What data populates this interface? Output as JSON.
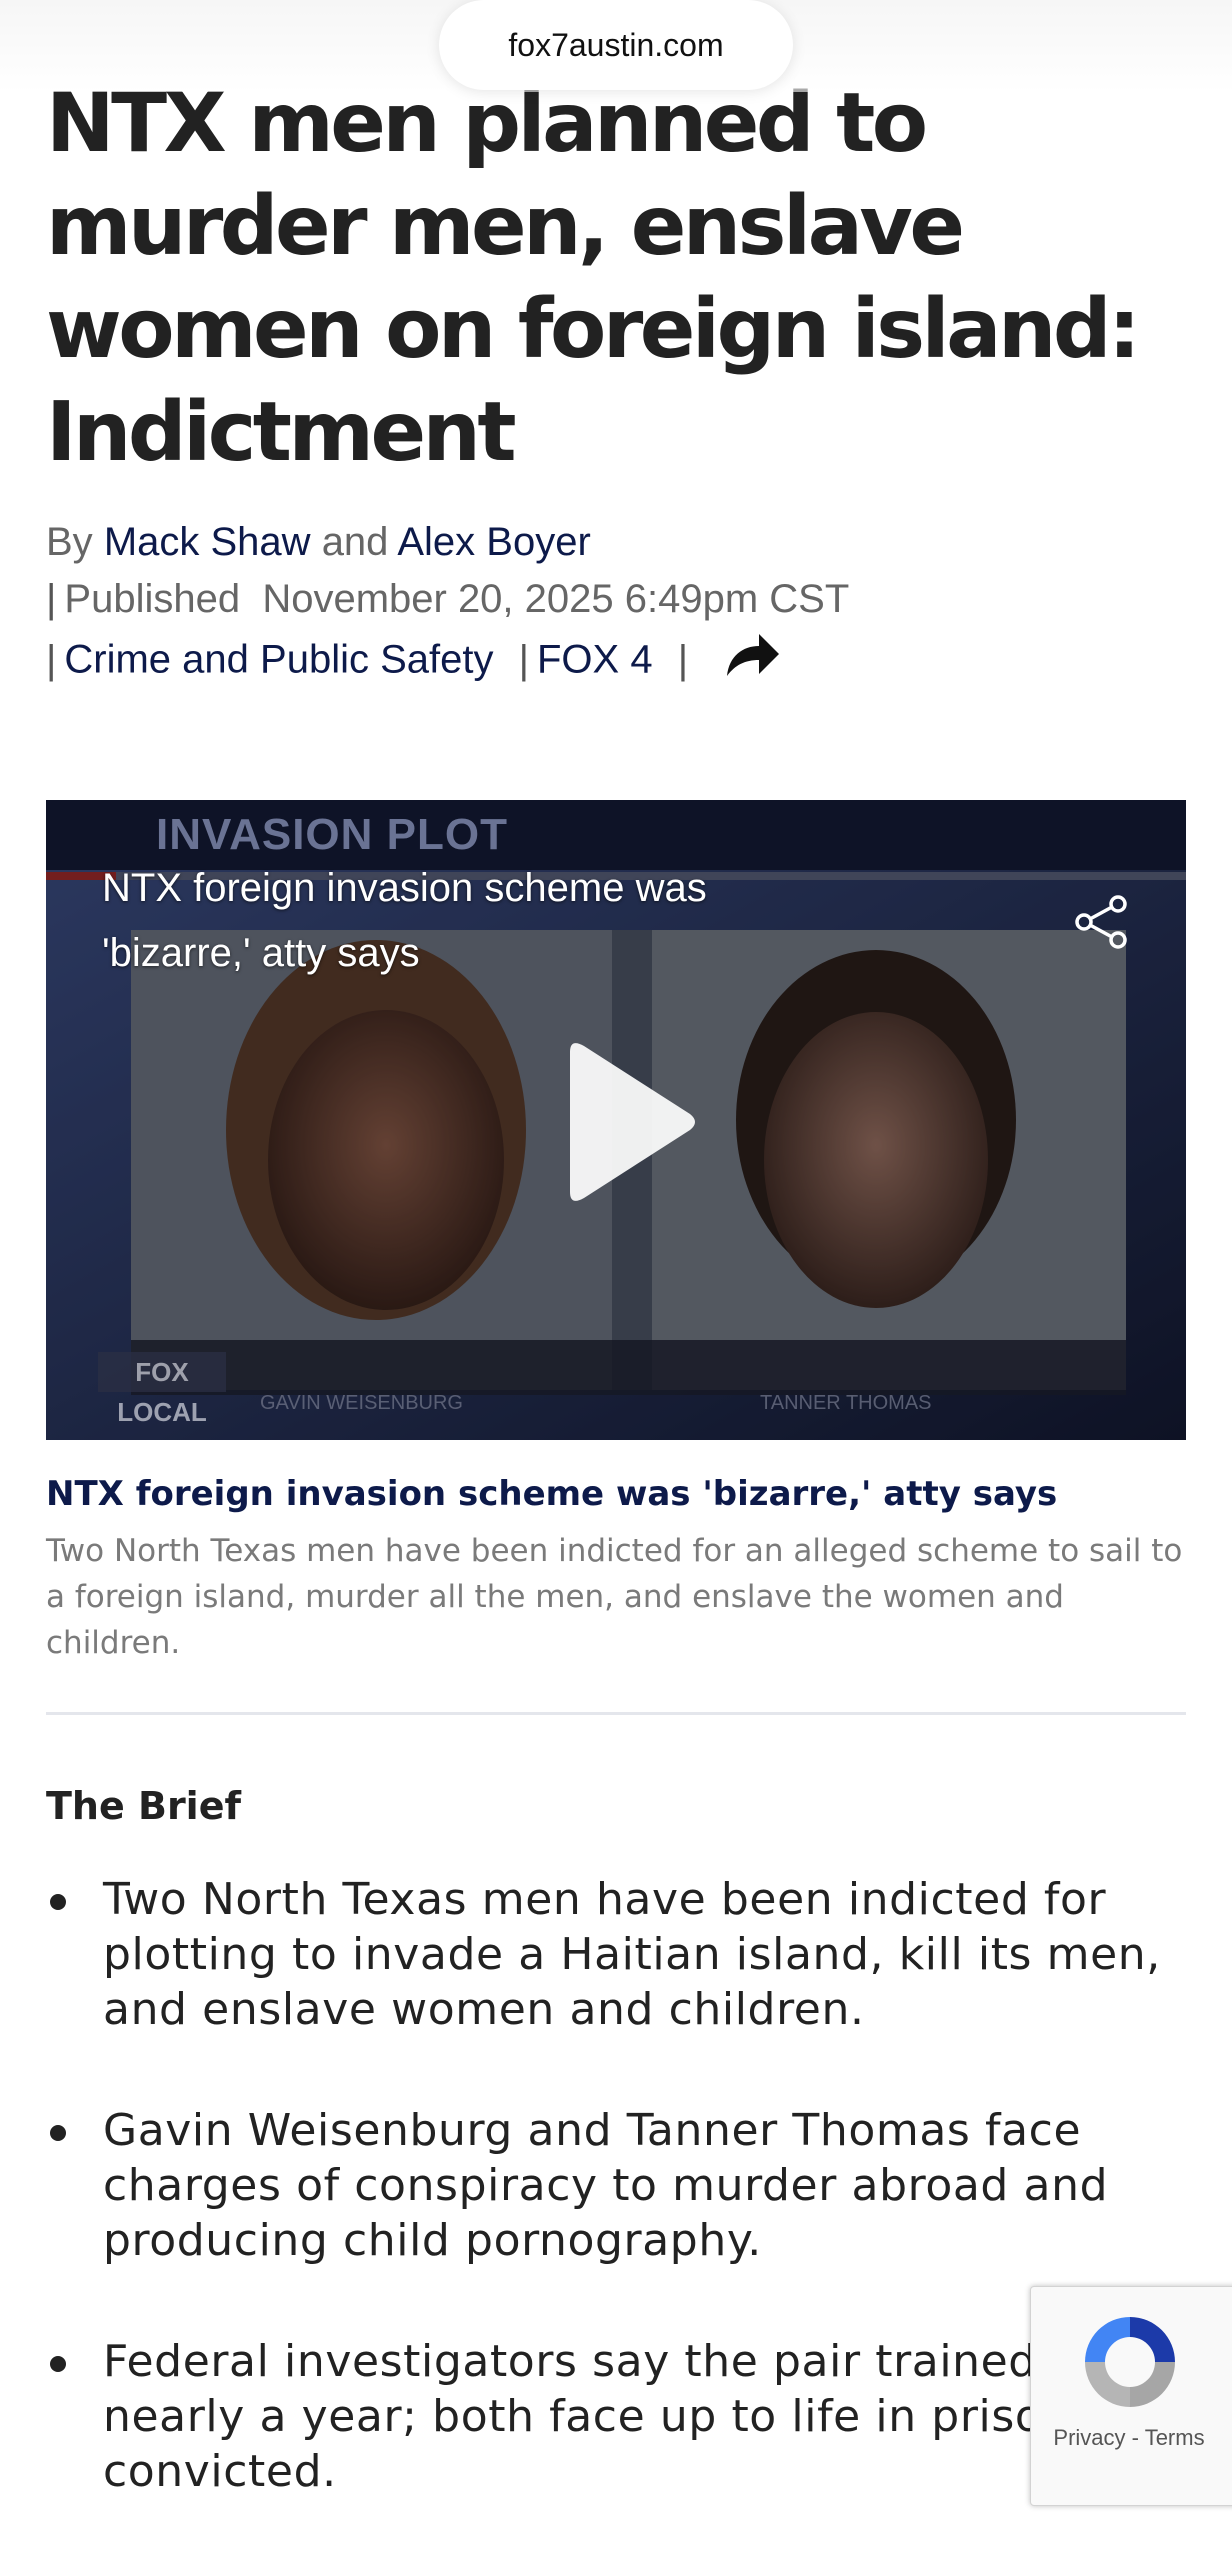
{
  "browser": {
    "url": "fox7austin.com"
  },
  "article": {
    "headline": "NTX men planned to murder men, enslave women on foreign island: Indictment",
    "byline_prefix": "By",
    "author_1": "Mack Shaw",
    "and": "and",
    "author_2": "Alex Boyer",
    "pipe": "|",
    "published_label": "Published",
    "published_date": "November 20, 2025 6:49pm CST",
    "category": "Crime and Public Safety",
    "station": "FOX 4"
  },
  "video": {
    "title": "NTX foreign invasion scheme was 'bizarre,' atty says",
    "banner": "INVASION PLOT",
    "logo": "FOX LOCAL",
    "name_left": "GAVIN WEISENBURG",
    "name_right": "TANNER THOMAS",
    "icons": {
      "share": "share-nodes-icon",
      "play": "play-icon"
    }
  },
  "caption": {
    "title": "NTX foreign invasion scheme was 'bizarre,' atty says",
    "description": "Two North Texas men have been indicted for an alleged scheme to sail to a foreign island, murder all the men, and enslave the women and children."
  },
  "brief": {
    "title": "The Brief",
    "items": [
      "Two North Texas men have been indicted for plotting to invade a Haitian island, kill its men, and enslave women and children.",
      "Gavin Weisenburg and Tanner Thomas face charges of conspiracy to murder abroad and producing child pornography.",
      "Federal investigators say the pair trained for nearly a year; both face up to life in prison if convicted."
    ]
  },
  "recaptcha": {
    "privacy": "Privacy",
    "dash": " - ",
    "terms": "Terms"
  },
  "colors": {
    "link": "#0d1a4a",
    "text": "#222222",
    "muted": "#7a7a7a"
  }
}
